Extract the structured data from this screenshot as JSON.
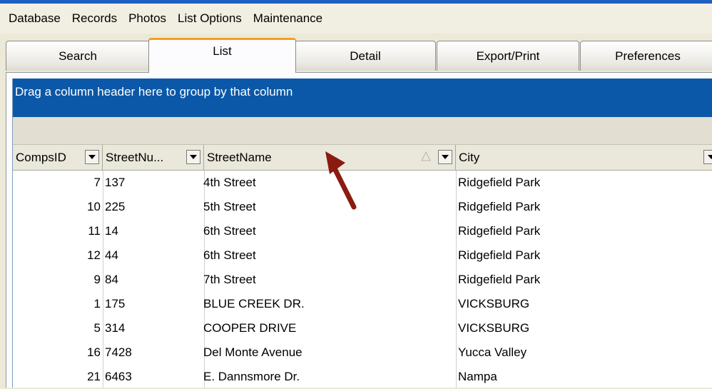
{
  "menu": [
    "Database",
    "Records",
    "Photos",
    "List Options",
    "Maintenance"
  ],
  "tabs": [
    "Search",
    "List",
    "Detail",
    "Export/Print",
    "Preferences"
  ],
  "active_tab": "List",
  "grid": {
    "group_prompt": "Drag a column header here to group by that column",
    "columns": [
      "CompsID",
      "StreetNu...",
      "StreetName",
      "City"
    ],
    "sort_column": "StreetName",
    "rows": [
      {
        "id": "7",
        "num": "137",
        "street": "4th Street",
        "city": "Ridgefield Park"
      },
      {
        "id": "10",
        "num": "225",
        "street": "5th Street",
        "city": "Ridgefield Park"
      },
      {
        "id": "11",
        "num": "14",
        "street": "6th Street",
        "city": "Ridgefield Park"
      },
      {
        "id": "12",
        "num": "44",
        "street": "6th Street",
        "city": "Ridgefield Park"
      },
      {
        "id": "9",
        "num": "84",
        "street": "7th Street",
        "city": "Ridgefield Park"
      },
      {
        "id": "1",
        "num": "175",
        "street": "BLUE CREEK DR.",
        "city": "VICKSBURG"
      },
      {
        "id": "5",
        "num": "314",
        "street": "COOPER DRIVE",
        "city": "VICKSBURG"
      },
      {
        "id": "16",
        "num": "7428",
        "street": "Del Monte Avenue",
        "city": "Yucca Valley"
      },
      {
        "id": "21",
        "num": "6463",
        "street": "E. Dannsmore Dr.",
        "city": "Nampa"
      }
    ]
  },
  "colors": {
    "group_panel": "#0b58a8",
    "active_tab_accent": "#f0a020",
    "annotation_arrow": "#8b1a10"
  },
  "icons": [
    "dropdown-arrow-icon",
    "sort-ascending-icon",
    "annotation-arrow"
  ]
}
